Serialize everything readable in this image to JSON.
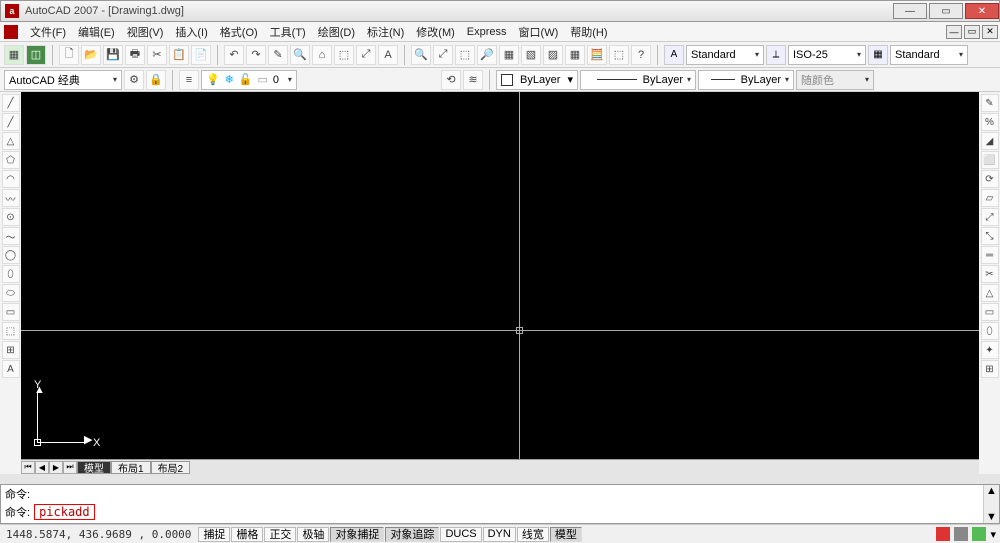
{
  "title": "AutoCAD 2007 - [Drawing1.dwg]",
  "menus": [
    "文件(F)",
    "编辑(E)",
    "视图(V)",
    "插入(I)",
    "格式(O)",
    "工具(T)",
    "绘图(D)",
    "标注(N)",
    "修改(M)",
    "Express",
    "窗口(W)",
    "帮助(H)"
  ],
  "toolbar1": {
    "styles": {
      "textStyle": "Standard",
      "dimStyle": "ISO-25",
      "tableStyle": "Standard"
    }
  },
  "toolbar2": {
    "workspace": "AutoCAD 经典",
    "layerInfo": "0",
    "colorCtrl": "ByLayer",
    "linetype": "ByLayer",
    "lineweight": "ByLayer",
    "colorSelect": "随颜色"
  },
  "sheet": {
    "tabs": [
      "模型",
      "布局1",
      "布局2"
    ],
    "activeIndex": 0
  },
  "ucs": {
    "y": "Y",
    "x": "X"
  },
  "command": {
    "promptLabel": "命令:",
    "current": "pickadd"
  },
  "status": {
    "coords": "1448.5874, 436.9689 , 0.0000",
    "toggles": [
      {
        "label": "捕捉",
        "pressed": false
      },
      {
        "label": "栅格",
        "pressed": false
      },
      {
        "label": "正交",
        "pressed": false
      },
      {
        "label": "极轴",
        "pressed": false
      },
      {
        "label": "对象捕捉",
        "pressed": true
      },
      {
        "label": "对象追踪",
        "pressed": true
      },
      {
        "label": "DUCS",
        "pressed": false
      },
      {
        "label": "DYN",
        "pressed": false
      },
      {
        "label": "线宽",
        "pressed": false
      },
      {
        "label": "模型",
        "pressed": true
      }
    ]
  },
  "icons": {
    "min": "—",
    "max": "▭",
    "close": "✕",
    "caret": "▾",
    "yhead": "▲",
    "xhead": "▶",
    "nav_first": "⏮",
    "nav_prev": "◀",
    "nav_next": "▶",
    "nav_last": "⏭",
    "up": "▲",
    "down": "▼"
  },
  "tb_btns_row1_group1": [
    "▦",
    "◫"
  ],
  "tb_btns_row1_group2": [
    "🗋",
    "📂",
    "💾",
    "🖶",
    "✂",
    "📋",
    "📄",
    "↶",
    "↷",
    "✎",
    "🔍",
    "⌂",
    "⬚",
    "⤢",
    "A"
  ],
  "tb_btns_row1_group3": [
    "🔍",
    "⤢",
    "⬚",
    "🔎",
    "▦",
    "▧",
    "▨",
    "▦",
    "🧮",
    "⬚",
    "?"
  ],
  "vtool_left": [
    "╱",
    "╱",
    "△",
    "⬠",
    "◠",
    "〰",
    "⊙",
    "〜",
    "◯",
    "⬯",
    "⬭",
    "▭",
    "⬚",
    "⊞",
    "A"
  ],
  "vtool_right": [
    "✎",
    "%",
    "◢",
    "⬜",
    "⟳",
    "▱",
    "⤢",
    "⤡",
    "═",
    "✂",
    "△",
    "▭",
    "⬯",
    "✦",
    "⊞"
  ]
}
